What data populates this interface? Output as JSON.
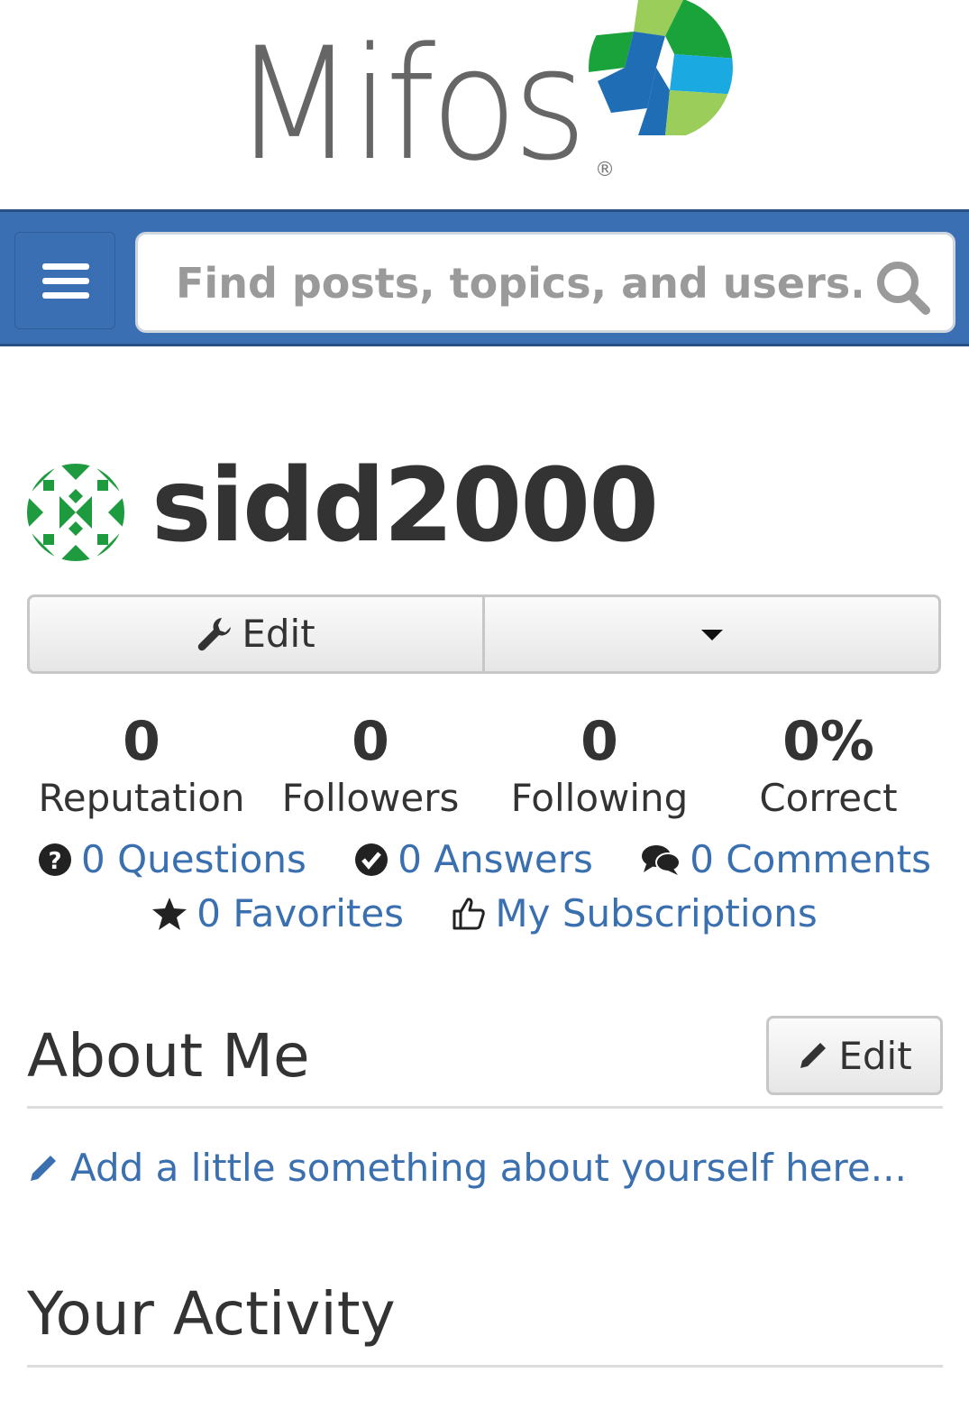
{
  "brand": {
    "logo_text": "Mifos",
    "registered_mark": "®"
  },
  "navbar": {
    "search_placeholder": "Find posts, topics, and users..."
  },
  "profile": {
    "username": "sidd2000",
    "edit_label": "Edit"
  },
  "stats": [
    {
      "value": "0",
      "label": "Reputation"
    },
    {
      "value": "0",
      "label": "Followers"
    },
    {
      "value": "0",
      "label": "Following"
    },
    {
      "value": "0%",
      "label": "Correct"
    }
  ],
  "activity_links": {
    "questions": "0 Questions",
    "answers": "0 Answers",
    "comments": "0 Comments",
    "favorites": "0 Favorites",
    "subscriptions": "My Subscriptions"
  },
  "about": {
    "title": "About Me",
    "edit_label": "Edit",
    "placeholder_link": "Add a little something about yourself here..."
  },
  "activity": {
    "title": "Your Activity"
  },
  "colors": {
    "nav_blue": "#3b6fb4",
    "link_blue": "#3a6fb0",
    "globe_green": "#1aa33b",
    "globe_blue": "#1e6db5",
    "globe_light_green": "#9acd5a",
    "globe_cyan": "#1aa9e0"
  }
}
